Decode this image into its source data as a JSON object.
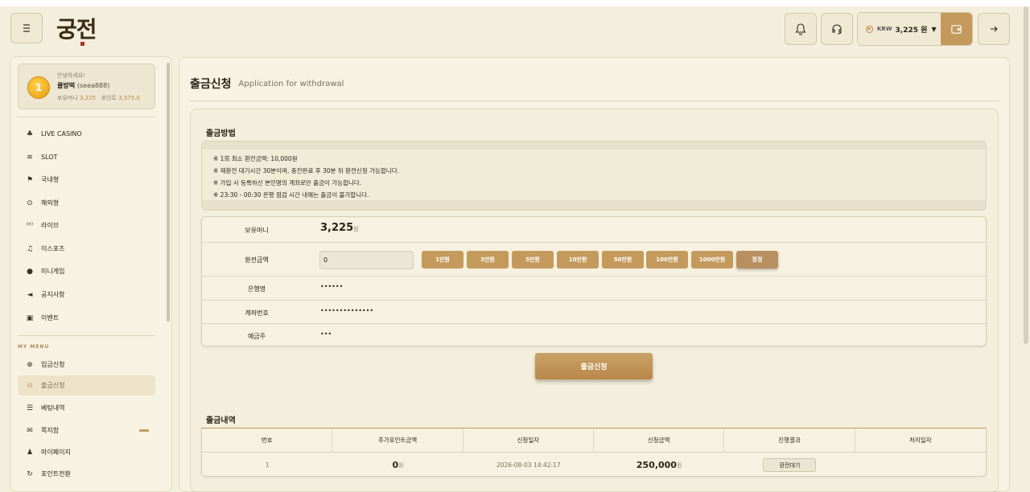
{
  "header": {
    "logo_text": "궁전",
    "currency": "KRW",
    "balance": "3,225 원",
    "colors": {
      "accent": "#c49a5c",
      "background": "#f4efdc"
    }
  },
  "sidebar": {
    "user": {
      "greeting": "안녕하세요!",
      "name": "쿨방떡",
      "id": "(seea888)",
      "money_label": "보유머니",
      "money_value": "3,225",
      "point_label": "포인트",
      "point_value": "3,575.0"
    },
    "games": [
      {
        "label": "LIVE CASINO",
        "icon": "cards-icon"
      },
      {
        "label": "SLOT",
        "icon": "coins-icon"
      },
      {
        "label": "국내형",
        "icon": "flag-icon"
      },
      {
        "label": "해외형",
        "icon": "globe-icon"
      },
      {
        "label": "라이브",
        "icon": "broadcast-icon"
      },
      {
        "label": "이스포츠",
        "icon": "headset-icon"
      },
      {
        "label": "미니게임",
        "icon": "gamepad-icon"
      },
      {
        "label": "공지사항",
        "icon": "megaphone-icon"
      },
      {
        "label": "이벤트",
        "icon": "gift-icon"
      }
    ],
    "my_menu_label": "MY MENU",
    "my_menu": [
      {
        "label": "입금신청",
        "icon": "plus-circle-icon"
      },
      {
        "label": "출금신청",
        "icon": "minus-circle-icon"
      },
      {
        "label": "베팅내역",
        "icon": "list-icon"
      },
      {
        "label": "쪽지함",
        "icon": "mail-icon"
      },
      {
        "label": "마이페이지",
        "icon": "user-icon"
      },
      {
        "label": "포인트전환",
        "icon": "refresh-icon"
      }
    ]
  },
  "main": {
    "title": "출금신청",
    "subtitle": "Application for withdrawal",
    "method_title": "출금방법",
    "notice_lines": [
      "※ 1회 최소 환전금액: 10,000원",
      "※ 재환전 대기시간 30분이며, 충전완료 후 30분 뒤 환전신청 가능합니다.",
      "※ 가입 시 등록하신 본인명의 계좌로만 출금이 가능합니다.",
      "※ 23:30 - 00:30 은행 점검 시간 내에는 출금이 불가합니다."
    ],
    "form": {
      "money_label": "보유머니",
      "money_value": "3,225",
      "money_unit": "원",
      "amount_label": "환전금액",
      "amount_value": "0",
      "chips": [
        "1만원",
        "3만원",
        "5만원",
        "10만원",
        "50만원",
        "100만원",
        "1000만원"
      ],
      "reset_label": "정정",
      "bank_label": "은행명",
      "bank_value": "••••••",
      "account_label": "계좌번호",
      "account_value": "••••••••••••••",
      "holder_label": "예금주",
      "holder_value": "•••"
    },
    "submit_label": "출금신청",
    "history_title": "출금내역",
    "history_columns": [
      "번호",
      "추가포인트금액",
      "신청일자",
      "신청금액",
      "진행결과",
      "처리일자"
    ],
    "history_rows": [
      {
        "no": "1",
        "bonus": "0",
        "bonus_unit": "원",
        "date": "2026-08-03 14:42:17",
        "amount": "250,000",
        "amount_unit": "원",
        "status": "환전대기",
        "processed": ""
      }
    ]
  }
}
